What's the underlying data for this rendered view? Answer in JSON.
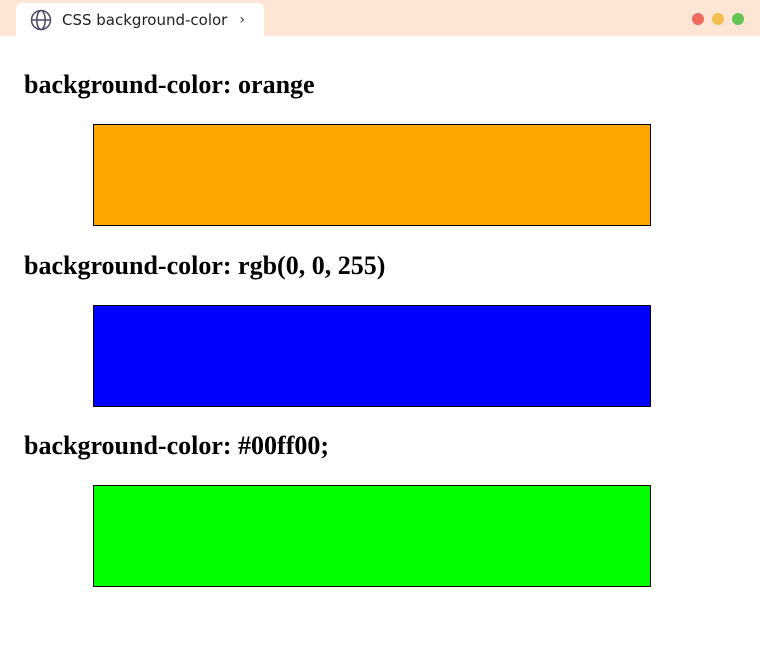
{
  "browser": {
    "tab_title": "CSS background-color",
    "tab_icon": "globe-icon",
    "tab_chevron": "›",
    "window_controls": [
      "#ed6a5e",
      "#f5bf4f",
      "#62c554"
    ]
  },
  "sections": [
    {
      "heading": "background-color: orange",
      "color": "orange"
    },
    {
      "heading": "background-color: rgb(0, 0, 255)",
      "color": "rgb(0, 0, 255)"
    },
    {
      "heading": "background-color: #00ff00;",
      "color": "#00ff00"
    }
  ]
}
